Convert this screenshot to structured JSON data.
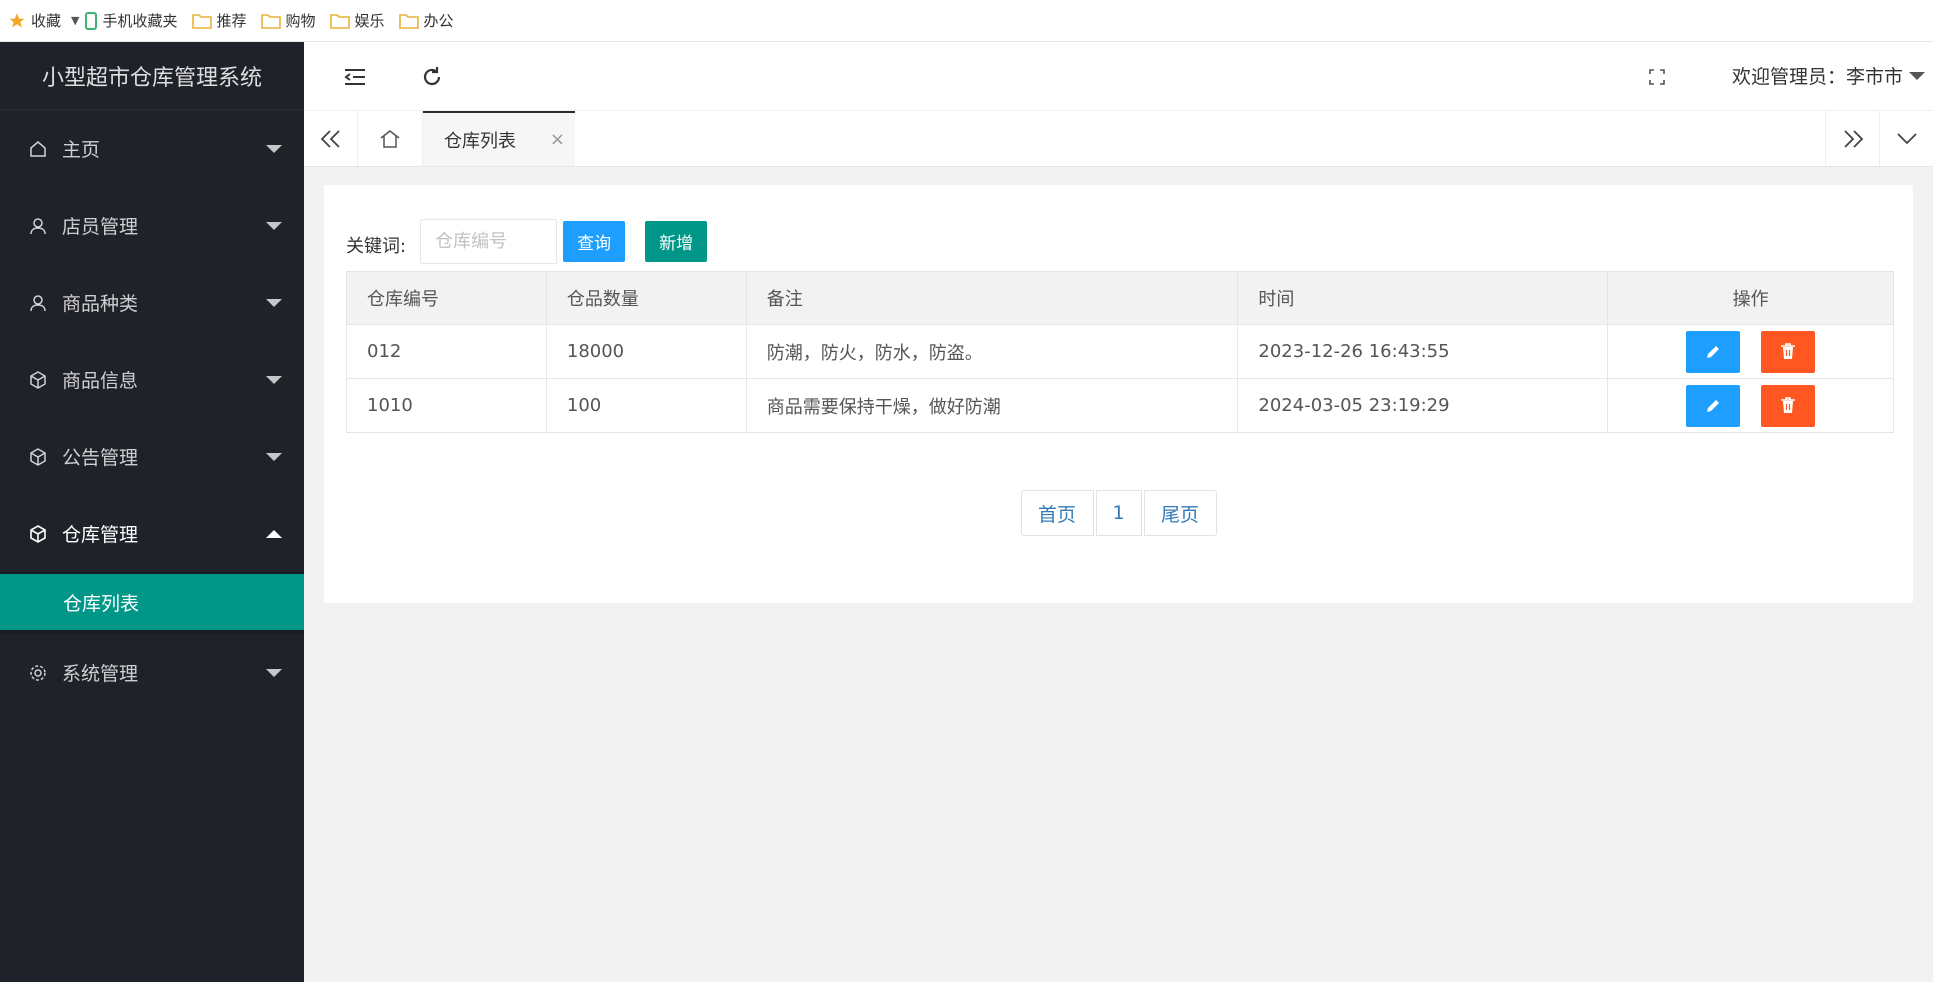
{
  "bookmarks": [
    {
      "label": "收藏",
      "icon": "star-icon"
    },
    {
      "label": "手机收藏夹",
      "icon": "phone-icon"
    },
    {
      "label": "推荐",
      "icon": "folder-icon"
    },
    {
      "label": "购物",
      "icon": "folder-icon"
    },
    {
      "label": "娱乐",
      "icon": "folder-icon"
    },
    {
      "label": "办公",
      "icon": "folder-icon"
    }
  ],
  "app": {
    "title": "小型超市仓库管理系统",
    "welcome": "欢迎管理员：李市市"
  },
  "sidebar": {
    "items": [
      {
        "label": "主页",
        "icon": "home-icon"
      },
      {
        "label": "店员管理",
        "icon": "user-icon"
      },
      {
        "label": "商品种类",
        "icon": "user-icon"
      },
      {
        "label": "商品信息",
        "icon": "cube-icon"
      },
      {
        "label": "公告管理",
        "icon": "cube-icon"
      },
      {
        "label": "仓库管理",
        "icon": "cube-icon"
      },
      {
        "label": "系统管理",
        "icon": "gear-icon"
      }
    ],
    "submenu": {
      "label": "仓库列表"
    }
  },
  "tabs": {
    "active": "仓库列表",
    "close": "×"
  },
  "search": {
    "label": "关键词:",
    "placeholder": "仓库编号",
    "query_button": "查询",
    "add_button": "新增"
  },
  "table": {
    "headers": [
      "仓库编号",
      "仓品数量",
      "备注",
      "时间",
      "操作"
    ],
    "rows": [
      {
        "id": "012",
        "qty": "18000",
        "note": "防潮，防火，防水，防盗。",
        "time": "2023-12-26 16:43:55"
      },
      {
        "id": "1010",
        "qty": "100",
        "note": "商品需要保持干燥，做好防潮",
        "time": "2024-03-05 23:19:29"
      }
    ]
  },
  "pagination": {
    "first": "首页",
    "page": "1",
    "last": "尾页"
  },
  "colors": {
    "sidebar_bg": "#20222a",
    "accent_green": "#009688",
    "accent_blue": "#1e9fff",
    "danger": "#ff5722",
    "content_bg": "#f2f2f2"
  }
}
